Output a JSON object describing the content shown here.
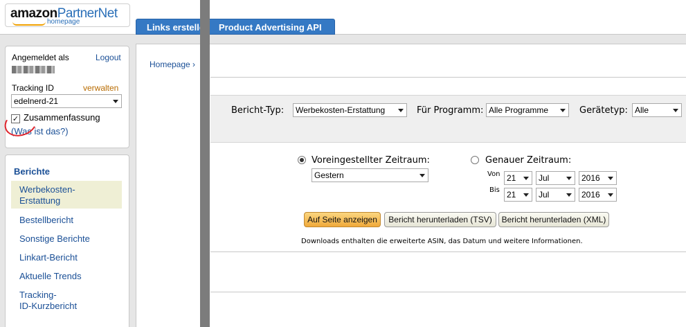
{
  "header": {
    "logo_amazon": "amazon",
    "logo_partner": "PartnerNet",
    "logo_sub": "homepage",
    "tabs": [
      {
        "label": "Links erstellen"
      },
      {
        "label": "Product Advertising API"
      }
    ]
  },
  "account": {
    "logged_in_label": "Angemeldet als",
    "logout_label": "Logout",
    "tracking_label": "Tracking ID",
    "manage_label": "verwalten",
    "tracking_value": "edelnerd-21",
    "summary_label": "Zusammenfassung",
    "summary_checked": true,
    "whatis_prefix": "(",
    "whatis_label": "Was ist das?",
    "whatis_suffix": ")"
  },
  "reports": {
    "title": "Berichte",
    "items": [
      {
        "label_line1": "Werbekosten-",
        "label_line2": "Erstattung"
      },
      {
        "label": "Bestellbericht"
      },
      {
        "label": "Sonstige Berichte"
      },
      {
        "label": "Linkart-Bericht"
      },
      {
        "label": "Aktuelle Trends"
      },
      {
        "label_line1": "Tracking-",
        "label_line2": "ID-Kurzbericht"
      }
    ]
  },
  "breadcrumb": "Homepage ›",
  "filters": {
    "report_type_label": "Bericht-Typ:",
    "report_type_value": "Werbekosten-Erstattung",
    "program_label": "Für Programm:",
    "program_value": "Alle Programme",
    "device_label": "Gerätetyp:",
    "device_value": "Alle"
  },
  "period": {
    "preset_label": "Voreingestellter Zeitraum:",
    "preset_value": "Gestern",
    "exact_label": "Genauer Zeitraum:",
    "from_label": "Von",
    "to_label": "Bis",
    "from_day": "21",
    "from_month": "Jul",
    "from_year": "2016",
    "to_day": "21",
    "to_month": "Jul",
    "to_year": "2016"
  },
  "actions": {
    "show_label": "Auf Seite anzeigen",
    "download_tsv_label": "Bericht herunterladen (TSV)",
    "download_xml_label": "Bericht herunterladen (XML)",
    "note": "Downloads enthalten die erweiterte ASIN, das Datum und weitere Informationen."
  },
  "colors": {
    "link": "#1a4f96",
    "tab": "#3579c4",
    "primary_button": "#f0a93a",
    "annotation": "#e0242c"
  }
}
